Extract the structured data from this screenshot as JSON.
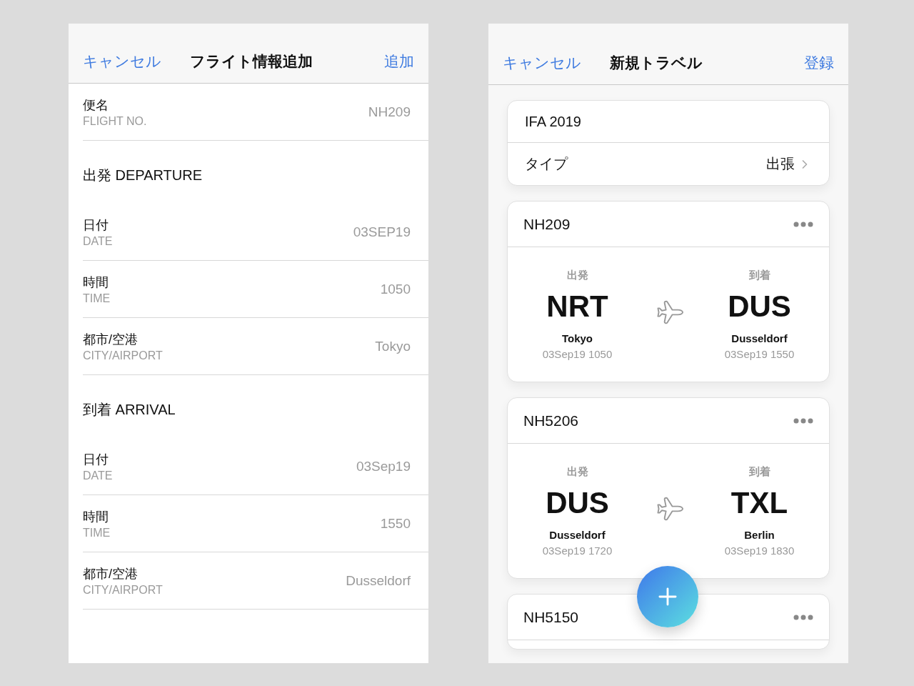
{
  "flight_form": {
    "header": {
      "cancel": "キャンセル",
      "title": "フライト情報追加",
      "action": "追加"
    },
    "fields": [
      {
        "label": "便名",
        "sublabel": "FLIGHT NO.",
        "value": "NH209"
      }
    ],
    "sections": [
      {
        "title": "出発 DEPARTURE",
        "fields": [
          {
            "label": "日付",
            "sublabel": "DATE",
            "value": "03SEP19"
          },
          {
            "label": "時間",
            "sublabel": "TIME",
            "value": "1050"
          },
          {
            "label": "都市/空港",
            "sublabel": "CITY/AIRPORT",
            "value": "Tokyo"
          }
        ]
      },
      {
        "title": "到着 ARRIVAL",
        "fields": [
          {
            "label": "日付",
            "sublabel": "DATE",
            "value": "03Sep19"
          },
          {
            "label": "時間",
            "sublabel": "TIME",
            "value": "1550"
          },
          {
            "label": "都市/空港",
            "sublabel": "CITY/AIRPORT",
            "value": "Dusseldorf"
          }
        ]
      }
    ]
  },
  "new_travel": {
    "header": {
      "cancel": "キャンセル",
      "title": "新規トラベル",
      "action": "登録"
    },
    "trip": {
      "name": "IFA 2019",
      "type_label": "タイプ",
      "type_value": "出張"
    },
    "flights": [
      {
        "number": "NH209",
        "departure": {
          "label": "出発",
          "code": "NRT",
          "city": "Tokyo",
          "datetime": "03Sep19 1050"
        },
        "arrival": {
          "label": "到着",
          "code": "DUS",
          "city": "Dusseldorf",
          "datetime": "03Sep19 1550"
        }
      },
      {
        "number": "NH5206",
        "departure": {
          "label": "出発",
          "code": "DUS",
          "city": "Dusseldorf",
          "datetime": "03Sep19 1720"
        },
        "arrival": {
          "label": "到着",
          "code": "TXL",
          "city": "Berlin",
          "datetime": "03Sep19 1830"
        }
      },
      {
        "number": "NH5150"
      }
    ]
  }
}
